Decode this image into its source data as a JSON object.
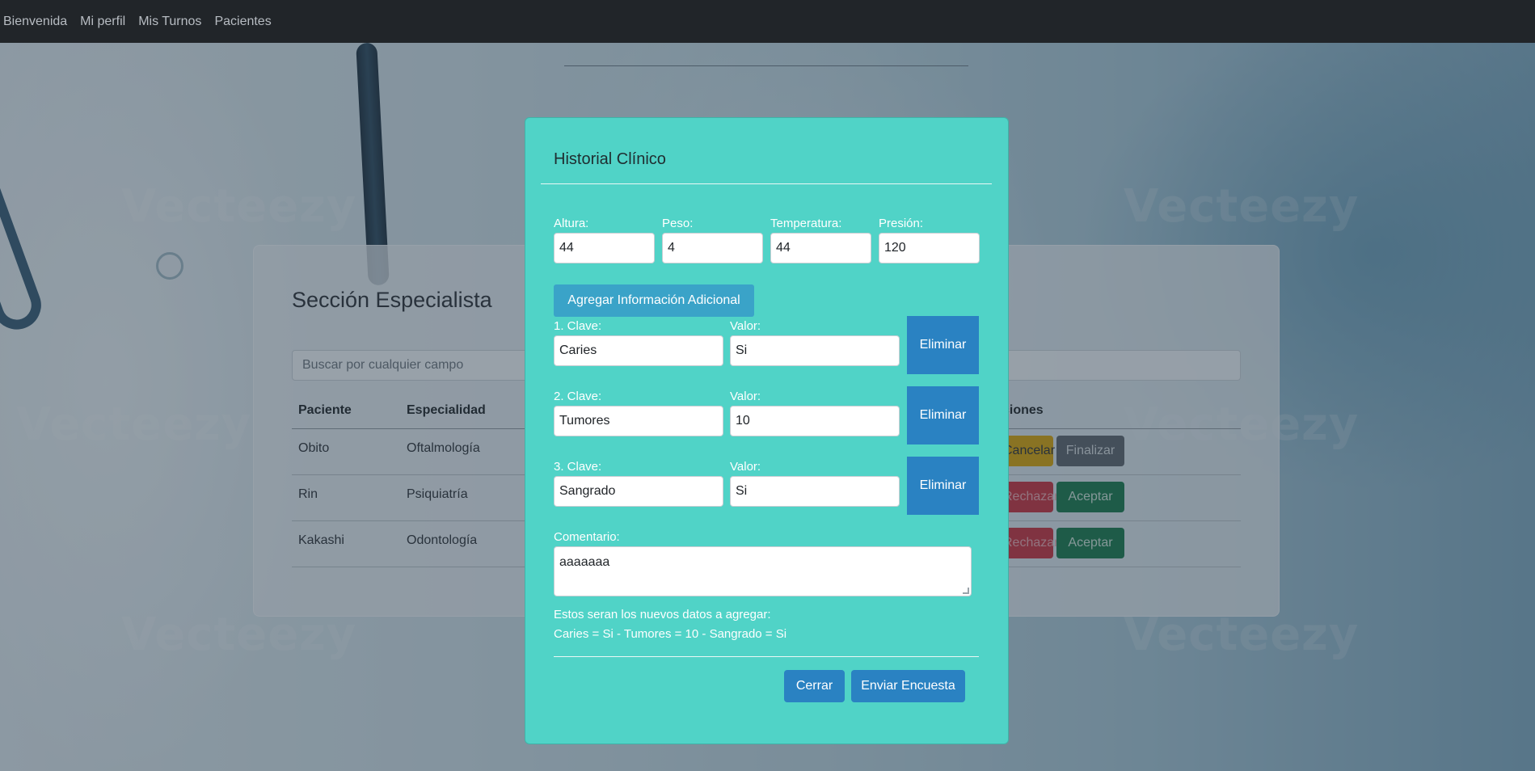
{
  "nav": {
    "items": [
      "Bienvenida",
      "Mi perfil",
      "Mis Turnos",
      "Pacientes"
    ]
  },
  "background": {
    "watermark": "Vecteezy"
  },
  "card": {
    "title": "Sección Especialista",
    "search_placeholder": "Buscar por cualquier campo",
    "headers": [
      "Paciente",
      "Especialidad",
      "ciones"
    ],
    "rows": [
      {
        "paciente": "Obito",
        "especialidad": "Oftalmología",
        "actions": [
          "Cancelar",
          "Finalizar"
        ]
      },
      {
        "paciente": "Rin",
        "especialidad": "Psiquiatría",
        "actions": [
          "Rechazar",
          "Aceptar"
        ]
      },
      {
        "paciente": "Kakashi",
        "especialidad": "Odontología",
        "actions": [
          "Rechazar",
          "Aceptar"
        ]
      }
    ]
  },
  "modal": {
    "title": "Historial Clínico",
    "vitals": [
      {
        "label": "Altura:",
        "value": "44"
      },
      {
        "label": "Peso:",
        "value": "4"
      },
      {
        "label": "Temperatura:",
        "value": "44"
      },
      {
        "label": "Presión:",
        "value": "120"
      }
    ],
    "add_info_label": "Agregar Información Adicional",
    "extra": [
      {
        "key_label": "1. Clave:",
        "key": "Caries",
        "value_label": "Valor:",
        "value": "Si",
        "delete_label": "Eliminar"
      },
      {
        "key_label": "2. Clave:",
        "key": "Tumores",
        "value_label": "Valor:",
        "value": "10",
        "delete_label": "Eliminar"
      },
      {
        "key_label": "3. Clave:",
        "key": "Sangrado",
        "value_label": "Valor:",
        "value": "Si",
        "delete_label": "Eliminar"
      }
    ],
    "comment_label": "Comentario:",
    "comment_value": "aaaaaaa",
    "summary_label": "Estos seran los nuevos datos a agregar:",
    "summary_value": "Caries = Si - Tumores = 10 - Sangrado = Si",
    "close_label": "Cerrar",
    "submit_label": "Enviar Encuesta"
  },
  "colors": {
    "modal_bg": "#50d3c7",
    "primary": "#2a82c2",
    "info": "#3aa3c8",
    "warning": "#d9a406",
    "danger": "#c9303c",
    "success": "#16794a",
    "secondary": "#5b636a",
    "nav_bg": "#212529"
  }
}
